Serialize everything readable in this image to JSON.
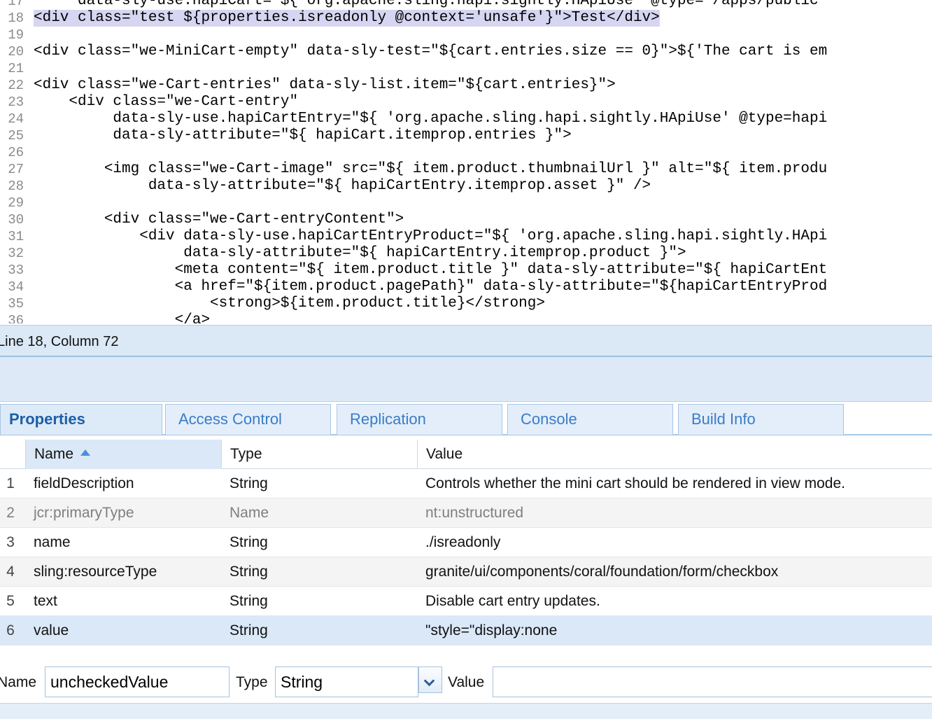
{
  "editor": {
    "lines": [
      {
        "n": "17",
        "text": "     data-sly-use.hapiCart=\"${'org.apache.sling.hapi.sightly.HApiUse' @type='/apps/public"
      },
      {
        "n": "18",
        "text": "<div class=\"test ${properties.isreadonly @context='unsafe'}\">Test</div>",
        "highlight": true
      },
      {
        "n": "19",
        "text": ""
      },
      {
        "n": "20",
        "text": "<div class=\"we-MiniCart-empty\" data-sly-test=\"${cart.entries.size == 0}\">${'The cart is em"
      },
      {
        "n": "21",
        "text": ""
      },
      {
        "n": "22",
        "text": "<div class=\"we-Cart-entries\" data-sly-list.item=\"${cart.entries}\">"
      },
      {
        "n": "23",
        "text": "    <div class=\"we-Cart-entry\""
      },
      {
        "n": "24",
        "text": "         data-sly-use.hapiCartEntry=\"${ 'org.apache.sling.hapi.sightly.HApiUse' @type=hapi"
      },
      {
        "n": "25",
        "text": "         data-sly-attribute=\"${ hapiCart.itemprop.entries }\">"
      },
      {
        "n": "26",
        "text": ""
      },
      {
        "n": "27",
        "text": "        <img class=\"we-Cart-image\" src=\"${ item.product.thumbnailUrl }\" alt=\"${ item.produ"
      },
      {
        "n": "28",
        "text": "             data-sly-attribute=\"${ hapiCartEntry.itemprop.asset }\" />"
      },
      {
        "n": "29",
        "text": ""
      },
      {
        "n": "30",
        "text": "        <div class=\"we-Cart-entryContent\">"
      },
      {
        "n": "31",
        "text": "            <div data-sly-use.hapiCartEntryProduct=\"${ 'org.apache.sling.hapi.sightly.HApi"
      },
      {
        "n": "32",
        "text": "                 data-sly-attribute=\"${ hapiCartEntry.itemprop.product }\">"
      },
      {
        "n": "33",
        "text": "                <meta content=\"${ item.product.title }\" data-sly-attribute=\"${ hapiCartEnt"
      },
      {
        "n": "34",
        "text": "                <a href=\"${item.product.pagePath}\" data-sly-attribute=\"${hapiCartEntryProd"
      },
      {
        "n": "35",
        "text": "                    <strong>${item.product.title}</strong>"
      },
      {
        "n": "36",
        "text": "                </a>"
      }
    ]
  },
  "status_bar": {
    "text": "Line 18, Column 72"
  },
  "tabs": [
    {
      "label": "Properties",
      "active": true
    },
    {
      "label": "Access Control",
      "active": false
    },
    {
      "label": "Replication",
      "active": false
    },
    {
      "label": "Console",
      "active": false
    },
    {
      "label": "Build Info",
      "active": false
    }
  ],
  "grid": {
    "columns": {
      "name": "Name",
      "type": "Type",
      "value": "Value"
    },
    "sort_icon": "sort-ascending-icon",
    "rows": [
      {
        "num": "1",
        "name": "fieldDescription",
        "type": "String",
        "value": "Controls whether the mini cart should be rendered in view mode."
      },
      {
        "num": "2",
        "name": "jcr:primaryType",
        "type": "Name",
        "value": "nt:unstructured",
        "dim": true
      },
      {
        "num": "3",
        "name": "name",
        "type": "String",
        "value": "./isreadonly"
      },
      {
        "num": "4",
        "name": "sling:resourceType",
        "type": "String",
        "value": "granite/ui/components/coral/foundation/form/checkbox"
      },
      {
        "num": "5",
        "name": "text",
        "type": "String",
        "value": "Disable cart entry updates."
      },
      {
        "num": "6",
        "name": "value",
        "type": "String",
        "value": "\"style=\"display:none",
        "selected": true
      }
    ]
  },
  "form": {
    "name_label": "Name",
    "name_value": "uncheckedValue",
    "type_label": "Type",
    "type_value": "String",
    "value_label": "Value",
    "value_value": ""
  },
  "colors": {
    "accent": "#3b7cc5",
    "panel_bg": "#dbe8f6",
    "selection": "#dae8f7",
    "code_highlight": "#d6d6f2"
  }
}
